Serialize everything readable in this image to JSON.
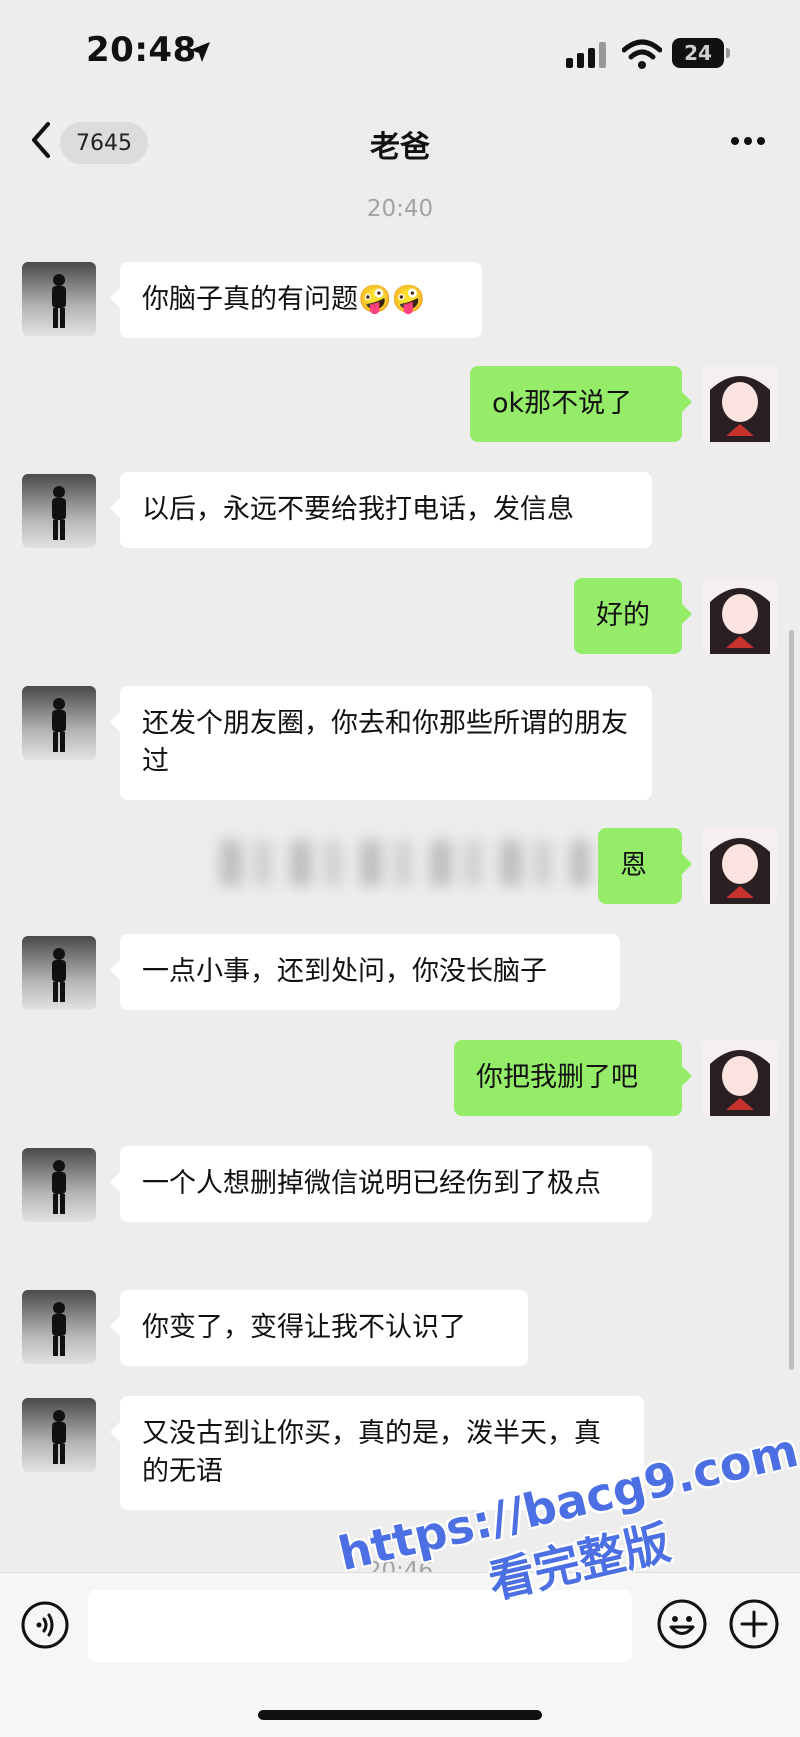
{
  "status_bar": {
    "time": "20:48",
    "battery": "24"
  },
  "header": {
    "back_badge": "7645",
    "title": "老爸"
  },
  "timestamps": {
    "first": "20:40",
    "second": "20:46"
  },
  "messages": [
    {
      "side": "in",
      "text": "你脑子真的有问题🤪🤪"
    },
    {
      "side": "out",
      "text": "ok那不说了"
    },
    {
      "side": "in",
      "text": "以后，永远不要给我打电话，发信息"
    },
    {
      "side": "out",
      "text": "好的"
    },
    {
      "side": "in",
      "text": "还发个朋友圈，你去和你那些所谓的朋友过"
    },
    {
      "side": "out",
      "text": "恩"
    },
    {
      "side": "in",
      "text": "一点小事，还到处问，你没长脑子"
    },
    {
      "side": "out",
      "text": "你把我删了吧"
    },
    {
      "side": "in",
      "text": "一个人想删掉微信说明已经伤到了极点"
    },
    {
      "side": "in",
      "text": "你变了，变得让我不认识了"
    },
    {
      "side": "in",
      "text": "又没古到让你买，真的是，泼半天，真的无语"
    }
  ],
  "watermark": {
    "line1": "https://bacg9.com",
    "line2": "看完整版"
  },
  "icons": {
    "back": "chevron-left-icon",
    "more": "more-dots-icon",
    "voice": "voice-icon",
    "emoji": "emoji-icon",
    "plus": "plus-icon",
    "location": "location-arrow-icon",
    "signal": "signal-icon",
    "wifi": "wifi-icon"
  },
  "colors": {
    "incoming_bubble": "#ffffff",
    "outgoing_bubble": "#95ec69",
    "background": "#ededed"
  }
}
